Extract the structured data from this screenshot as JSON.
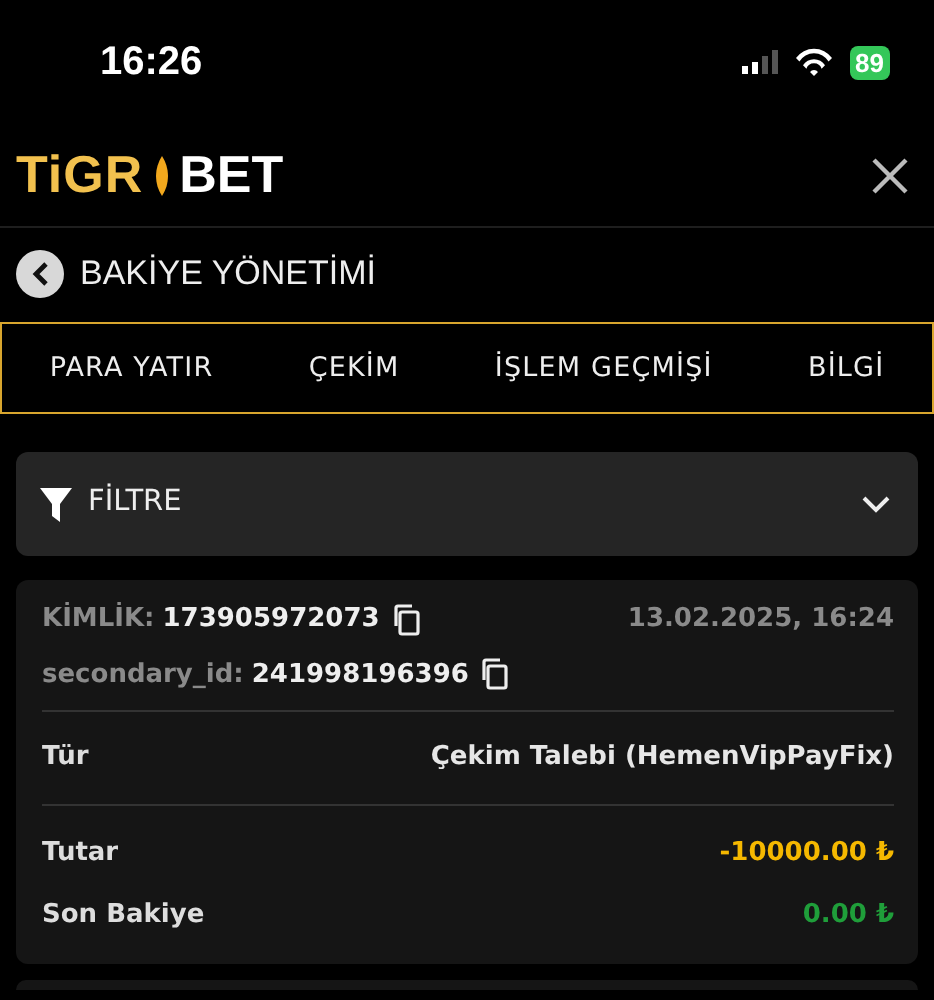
{
  "status_bar": {
    "time": "16:26",
    "battery": "89"
  },
  "header": {
    "logo_left": "TiGR",
    "logo_right": "BET"
  },
  "page_title": "BAKİYE YÖNETİMİ",
  "tabs": [
    {
      "label": "PARA YATIR",
      "selected": false
    },
    {
      "label": "ÇEKİM",
      "selected": false
    },
    {
      "label": "İŞLEM GEÇMİŞİ",
      "selected": false
    },
    {
      "label": "BİLGİ",
      "selected": false
    }
  ],
  "filter": {
    "label": "FİLTRE",
    "expanded": false
  },
  "transaction": {
    "id_label": "KİMLİK:",
    "id_value": "173905972073",
    "date": "13.02.2025, 16:24",
    "secondary_label": "secondary_id:",
    "secondary_value": "241998196396",
    "rows": [
      {
        "label": "Tür",
        "value": "Çekim Talebi (HemenVipPayFix)",
        "color": "#e6e6e6"
      },
      {
        "label": "Tutar",
        "value": "-10000.00 ₺",
        "color": "#f5b800"
      },
      {
        "label": "Son Bakiye",
        "value": "0.00 ₺",
        "color": "#1f9e3a"
      }
    ]
  }
}
